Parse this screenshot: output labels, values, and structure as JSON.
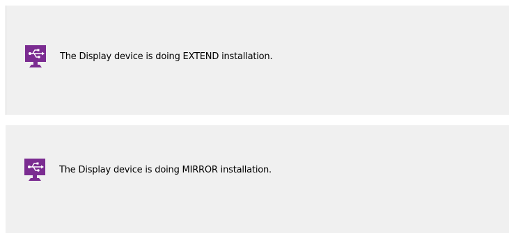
{
  "colors": {
    "panel_background": "#f0f0f0",
    "icon_purple": "#7b2c91",
    "icon_glyph": "#ffffff"
  },
  "notifications": [
    {
      "icon": "usb-display-icon",
      "message": "The Display device is doing EXTEND installation."
    },
    {
      "icon": "usb-display-icon",
      "message": "The Display device is doing MIRROR installation."
    }
  ]
}
